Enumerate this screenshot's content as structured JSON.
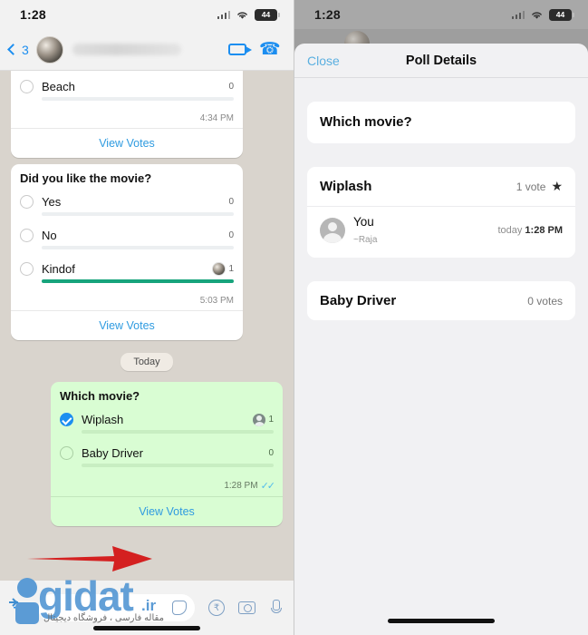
{
  "left_phone": {
    "status_bar": {
      "time": "1:28",
      "battery_level": "44",
      "wifi_icon": "wifi-icon",
      "signal_icon": "signal-bars-icon"
    },
    "chat_header": {
      "back_label": "3",
      "contact_name": "",
      "video_icon": "video-call-icon",
      "phone_icon": "voice-call-icon"
    },
    "polls": [
      {
        "question": "",
        "options": [
          {
            "label": "Beach",
            "count": "0",
            "percent": 0,
            "voted": false
          }
        ],
        "time": "4:34 PM",
        "view_votes_label": "View Votes"
      },
      {
        "question": "Did you like the movie?",
        "options": [
          {
            "label": "Yes",
            "count": "0",
            "percent": 0,
            "voted": false
          },
          {
            "label": "No",
            "count": "0",
            "percent": 0,
            "voted": false
          },
          {
            "label": "Kindof",
            "count": "1",
            "percent": 100,
            "voted": false
          }
        ],
        "time": "5:03 PM",
        "view_votes_label": "View Votes"
      }
    ],
    "day_divider": "Today",
    "outgoing_poll": {
      "question": "Which movie?",
      "options": [
        {
          "label": "Wiplash",
          "count": "1",
          "percent": 100,
          "voted": true
        },
        {
          "label": "Baby Driver",
          "count": "0",
          "percent": 0,
          "voted": false
        }
      ],
      "time": "1:28 PM",
      "read_receipt": "✓✓",
      "view_votes_label": "View Votes"
    },
    "input_bar": {
      "plus_label": "+",
      "placeholder": "",
      "sticker_icon": "sticker-icon",
      "payment_icon": "rupee-payment-icon",
      "camera_icon": "camera-icon",
      "mic_icon": "microphone-icon"
    },
    "watermark": {
      "brand": "gidat",
      "tld": ".ir",
      "subtitle": "مقاله فارسی ، فروشگاه دیجیتال"
    }
  },
  "right_phone": {
    "status_bar": {
      "time": "1:28",
      "battery_level": "44",
      "wifi_icon": "wifi-icon",
      "signal_icon": "signal-bars-icon"
    },
    "sheet": {
      "close_label": "Close",
      "title": "Poll Details",
      "question": "Which movie?",
      "options": [
        {
          "name": "Wiplash",
          "votes_label": "1 vote",
          "starred": true,
          "star_icon": "star-icon",
          "voters": [
            {
              "name": "You",
              "subtitle": "~Raja",
              "when_prefix": "today",
              "when_time": "1:28 PM"
            }
          ]
        },
        {
          "name": "Baby Driver",
          "votes_label": "0 votes",
          "starred": false,
          "voters": []
        }
      ]
    }
  },
  "annotation": {
    "arrow_color": "#d42020",
    "points_to": "View Votes"
  }
}
